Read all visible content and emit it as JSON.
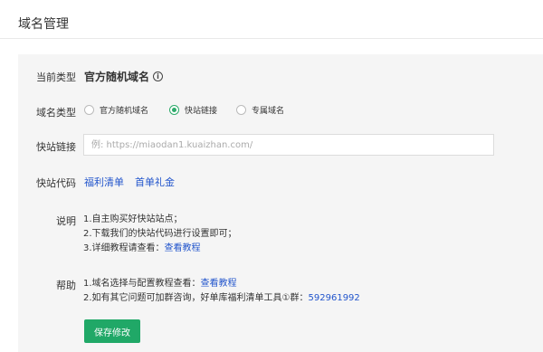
{
  "page": {
    "title": "域名管理"
  },
  "current_type": {
    "label": "当前类型",
    "value": "官方随机域名",
    "info_glyph": "i"
  },
  "domain_type": {
    "label": "域名类型",
    "options": [
      {
        "label": "官方随机域名",
        "checked": false
      },
      {
        "label": "快站链接",
        "checked": true
      },
      {
        "label": "专属域名",
        "checked": false
      }
    ]
  },
  "quick_link": {
    "label": "快站链接",
    "value": "",
    "placeholder": "例: https://miaodan1.kuaizhan.com/"
  },
  "quick_code": {
    "label": "快站代码",
    "links": [
      "福利清单",
      "首单礼金"
    ]
  },
  "description": {
    "label": "说明",
    "line1": "1.自主购买好快站站点；",
    "line2": "2.下载我们的快站代码进行设置即可；",
    "line3_prefix": "3.详细教程请查看：",
    "line3_link": "查看教程"
  },
  "help": {
    "label": "帮助",
    "line1_prefix": "1.域名选择与配置教程查看：",
    "line1_link": "查看教程",
    "line2_prefix": "2.如有其它问题可加群咨询，好单库福利清单工具①群：",
    "line2_link": "592961992"
  },
  "save_button": {
    "label": "保存修改"
  },
  "colors": {
    "accent": "#20a867",
    "link": "#2255cc",
    "panel_bg": "#f5f5f5"
  }
}
